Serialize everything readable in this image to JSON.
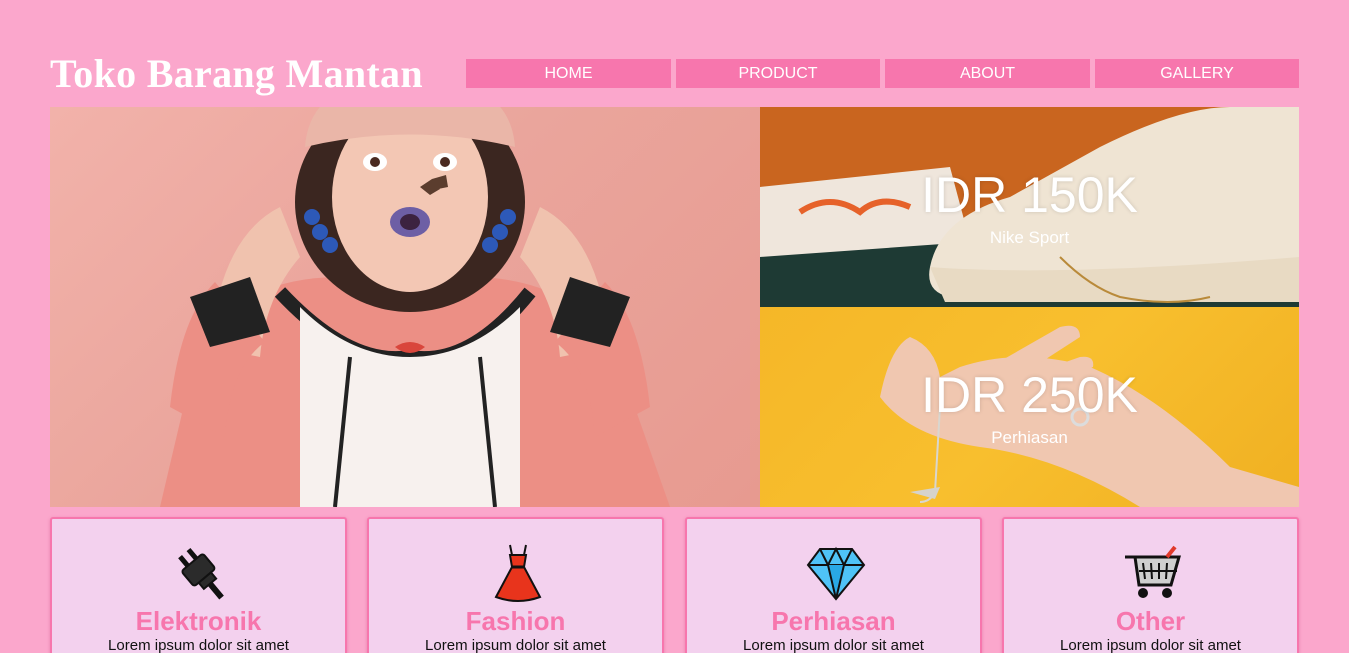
{
  "header": {
    "brand": "Toko Barang Mantan",
    "nav": [
      "HOME",
      "PRODUCT",
      "ABOUT",
      "GALLERY"
    ]
  },
  "hero": {
    "main_image": "fashion-model-photo",
    "promos": [
      {
        "price": "IDR 150K",
        "label": "Nike Sport",
        "image": "sneakers-photo"
      },
      {
        "price": "IDR 250K",
        "label": "Perhiasan",
        "image": "jewelry-hand-photo"
      }
    ]
  },
  "categories": [
    {
      "title": "Elektronik",
      "desc": "Lorem ipsum dolor sit amet",
      "icon": "plug-icon"
    },
    {
      "title": "Fashion",
      "desc": "Lorem ipsum dolor sit amet",
      "icon": "dress-icon"
    },
    {
      "title": "Perhiasan",
      "desc": "Lorem ipsum dolor sit amet",
      "icon": "diamond-icon"
    },
    {
      "title": "Other",
      "desc": "Lorem ipsum dolor sit amet",
      "icon": "shopping-cart-icon"
    }
  ],
  "colors": {
    "background": "#fba7cc",
    "accent": "#f776ad",
    "card": "#f3d1ee"
  }
}
